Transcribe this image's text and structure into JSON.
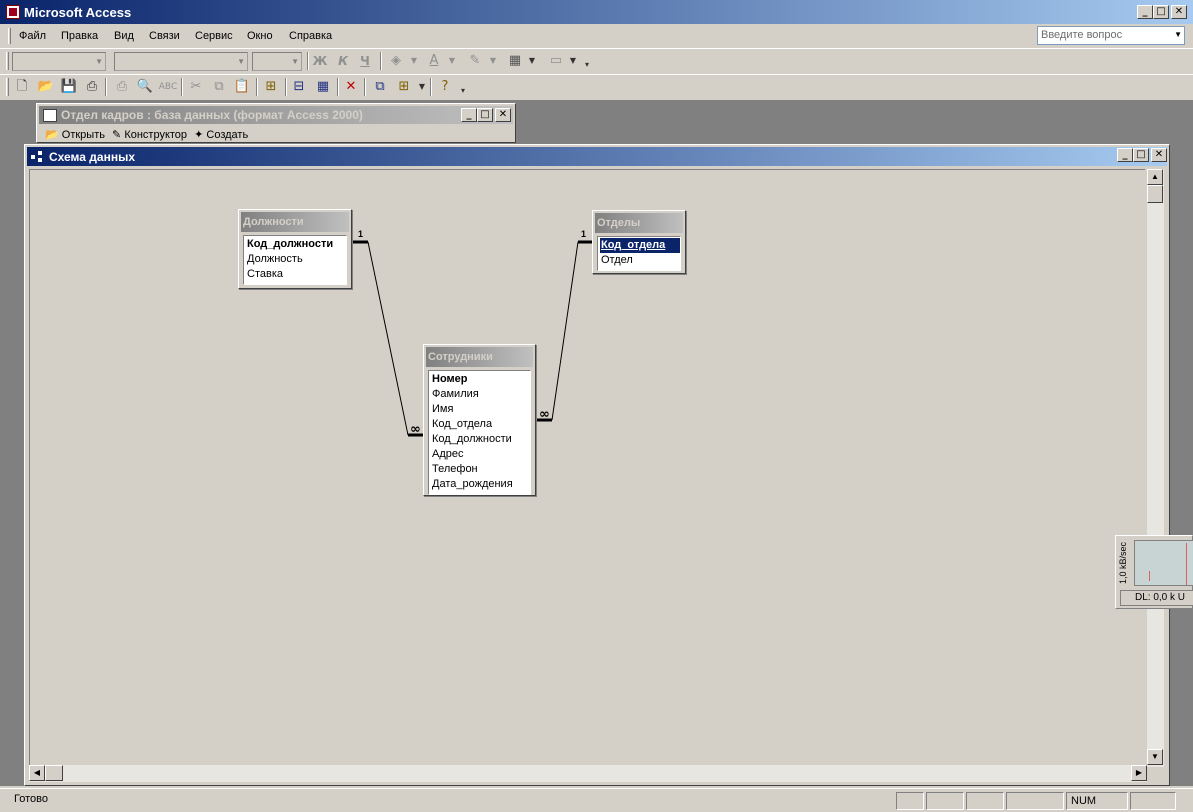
{
  "app": {
    "title": "Microsoft Access"
  },
  "menu": {
    "items": [
      "Файл",
      "Правка",
      "Вид",
      "Связи",
      "Сервис",
      "Окно",
      "Справка"
    ],
    "ask_placeholder": "Введите вопрос"
  },
  "format_toolbar": {
    "bold": "Ж",
    "italic": "К",
    "underline": "Ч"
  },
  "db_window": {
    "title": "Отдел кадров : база данных (формат Access 2000)",
    "toolbar": [
      "Открыть",
      "Конструктор",
      "Создать"
    ]
  },
  "schema_window": {
    "title": "Схема данных"
  },
  "tables": [
    {
      "name": "Должности",
      "fields": [
        "Код_должности",
        "Должность",
        "Ставка"
      ],
      "key": "Код_должности"
    },
    {
      "name": "Отделы",
      "fields": [
        "Код_отдела",
        "Отдел"
      ],
      "key": "Код_отдела",
      "selected": "Код_отдела"
    },
    {
      "name": "Сотрудники",
      "fields": [
        "Номер",
        "Фамилия",
        "Имя",
        "Код_отдела",
        "Код_должности",
        "Адрес",
        "Телефон",
        "Дата_рождения"
      ],
      "key": "Номер"
    }
  ],
  "relations": [
    {
      "from": "Должности.Код_должности",
      "to": "Сотрудники.Код_должности",
      "one": "1",
      "many": "∞"
    },
    {
      "from": "Отделы.Код_отдела",
      "to": "Сотрудники.Код_отдела",
      "one": "1",
      "many": "∞"
    }
  ],
  "meter": {
    "rate_label": "1,0 kB/sec",
    "dl_text": "DL: 0,0 k  U"
  },
  "status": {
    "ready": "Готово",
    "num": "NUM"
  },
  "colors": {
    "active_title": "#0a246a",
    "inactive_title": "#808080",
    "face": "#d4d0c8"
  }
}
